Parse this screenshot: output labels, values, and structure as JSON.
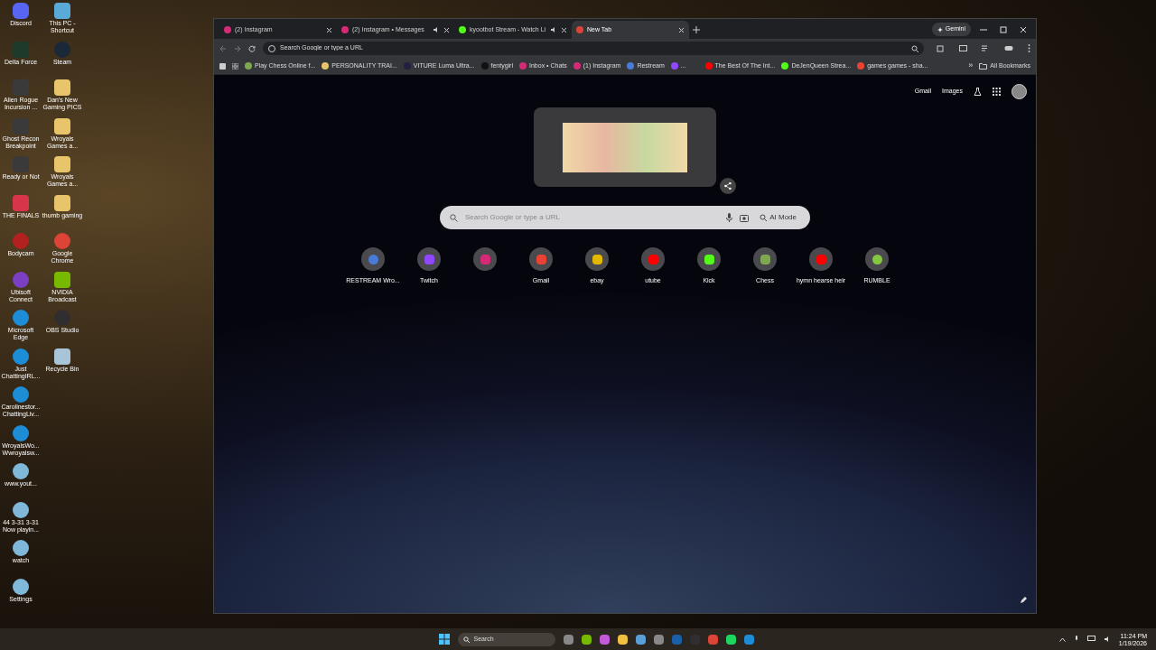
{
  "desktop": {
    "columns": [
      [
        {
          "label": "Discord",
          "kind": "discord"
        },
        {
          "label": "Delta Force",
          "kind": "delta"
        },
        {
          "label": "Alien Rogue Incursion ...",
          "kind": "game"
        },
        {
          "label": "Ghost Recon Breakpoint",
          "kind": "game"
        },
        {
          "label": "Ready or Not",
          "kind": "game"
        },
        {
          "label": "THE FINALS",
          "kind": "finals"
        },
        {
          "label": "Bodycam",
          "kind": "bodycam"
        },
        {
          "label": "Ubisoft Connect",
          "kind": "ubisoft"
        },
        {
          "label": "Microsoft Edge",
          "kind": "edge"
        },
        {
          "label": "Just ChattingIRL...",
          "kind": "edge"
        },
        {
          "label": "Carolinestor... ChattingLiv...",
          "kind": "edge"
        },
        {
          "label": "WroyalsWo... Wwroyalsw...",
          "kind": "edge"
        },
        {
          "label": "www.yout...",
          "kind": "web"
        },
        {
          "label": "44 3-31 3-31 Now playin...",
          "kind": "web"
        },
        {
          "label": "watch",
          "kind": "web"
        },
        {
          "label": "Settings",
          "kind": "web"
        }
      ],
      [
        {
          "label": "This PC - Shortcut",
          "kind": "pc"
        },
        {
          "label": "Steam",
          "kind": "steam"
        },
        {
          "label": "Dan's New Gaming PICS",
          "kind": "folder"
        },
        {
          "label": "Wroyals Games a...",
          "kind": "folder"
        },
        {
          "label": "Wroyals Games a...",
          "kind": "folder"
        },
        {
          "label": "thumb gaming",
          "kind": "folder"
        },
        {
          "label": "Google Chrome",
          "kind": "chrome"
        },
        {
          "label": "NVIDIA Broadcast",
          "kind": "nvidia"
        },
        {
          "label": "OBS Studio",
          "kind": "obs"
        },
        {
          "label": "Recycle Bin",
          "kind": "bin"
        }
      ]
    ]
  },
  "browser": {
    "tabs": [
      {
        "title": "(2) Instagram",
        "kind": "instagram",
        "audio": false,
        "selected": false
      },
      {
        "title": "(2) Instagram • Messages",
        "kind": "instagram",
        "audio": true,
        "selected": false
      },
      {
        "title": "kyootbot Stream - Watch Li",
        "kind": "kick",
        "audio": true,
        "selected": false
      },
      {
        "title": "New Tab",
        "kind": "chrome",
        "audio": false,
        "selected": true
      }
    ],
    "gemini": "Gemini",
    "omnibox": {
      "placeholder": "Search Google or type a URL"
    },
    "bookmarks": [
      {
        "label": "Play Chess Online f...",
        "kind": "chess"
      },
      {
        "label": "PERSONALITY TRAI...",
        "kind": "folder"
      },
      {
        "label": "VITURE Luma Ultra...",
        "kind": "viture"
      },
      {
        "label": "fentygirl",
        "kind": "fenty"
      },
      {
        "label": "Inbox • Chats",
        "kind": "instagram"
      },
      {
        "label": "(1) Instagram",
        "kind": "instagram"
      },
      {
        "label": "Restream",
        "kind": "restream"
      },
      {
        "label": "...",
        "kind": "twitch"
      },
      {
        "label": "The Best Of The Int...",
        "kind": "youtube"
      },
      {
        "label": "DeJenQueen Strea...",
        "kind": "kick"
      },
      {
        "label": "games games - sha...",
        "kind": "gmail"
      }
    ],
    "more_bookmarks": "»",
    "all_bookmarks": "All Bookmarks",
    "top_links": [
      "Gmail",
      "Images"
    ],
    "search": {
      "placeholder": "Search Google or type a URL",
      "ai_mode": "AI Mode"
    },
    "shortcuts": [
      {
        "label": "RESTREAM Wro...",
        "kind": "restream"
      },
      {
        "label": "Twitch",
        "kind": "twitch"
      },
      {
        "kind": "instagram"
      },
      {
        "label": "Gmail",
        "kind": "gmail"
      },
      {
        "label": "ebay",
        "kind": "ebay"
      },
      {
        "label": "utube",
        "kind": "youtube"
      },
      {
        "label": "Kick",
        "kind": "kick"
      },
      {
        "label": "Chess",
        "kind": "chess"
      },
      {
        "label": "hymn hearse heir",
        "kind": "youtube"
      },
      {
        "label": "RUMBLE",
        "kind": "rumble"
      }
    ]
  },
  "taskbar": {
    "search_placeholder": "Search",
    "time": "11:24 PM",
    "date": "1/19/2026"
  }
}
